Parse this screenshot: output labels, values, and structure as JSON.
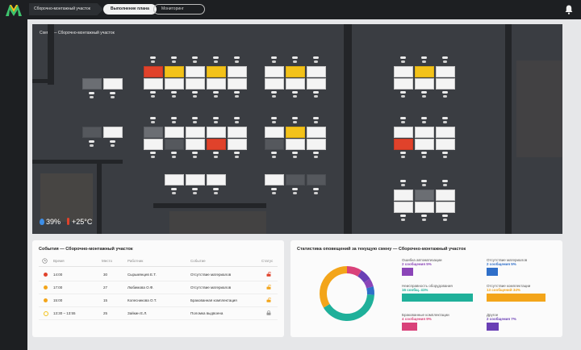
{
  "topbar": {
    "breadcrumb": "Сборочно-монтажный участок",
    "tab_active": "Выполнение плана",
    "tab_other": "Мониторинг"
  },
  "map": {
    "title": "Схема — Сборочно-монтажный участок",
    "humidity": "39%",
    "temperature": "+25°C"
  },
  "events": {
    "title": "События — Сборочно-монтажный участок",
    "columns": [
      "Время",
      "Место",
      "Работник",
      "Событие",
      "Статус"
    ],
    "rows": [
      {
        "time": "14:00",
        "place": "30",
        "worker": "Сырьмянцев Е.Т.",
        "event": "Отсутствие материалов",
        "level": "red"
      },
      {
        "time": "17:00",
        "place": "27",
        "worker": "Любимова О.Ф.",
        "event": "Отсутствие материалов",
        "level": "orange"
      },
      {
        "time": "15:00",
        "place": "15",
        "worker": "Колесникова О.Т.",
        "event": "Бракованная комплектация",
        "level": "orange"
      },
      {
        "time": "13:30 – 13:55",
        "place": "25",
        "worker": "Зайкин Е.Л.",
        "event": "Поломка выдвоена",
        "level": "open"
      }
    ],
    "colors": {
      "red": "#e0422b",
      "orange": "#f3a51a",
      "open": "#f3c21a"
    }
  },
  "stats": {
    "title": "Статистика оповещений за текущую смену — Сборочно-монтажный участок",
    "items": [
      {
        "label": "Ошибка автоматизации",
        "sub": "2 сообщения 5%",
        "value": 5,
        "color": "#8b45b8"
      },
      {
        "label": "Отсутствие материалов",
        "sub": "2 сообщения 5%",
        "value": 5,
        "color": "#2f6fc9"
      },
      {
        "label": "Неисправность оборудования",
        "sub": "16 сообщ. 41%",
        "value": 41,
        "color": "#1fb09a"
      },
      {
        "label": "Отсутствие комплектации",
        "sub": "13 сообщений 34%",
        "value": 34,
        "color": "#f3a51a"
      },
      {
        "label": "Бракованные комплектации",
        "sub": "4 сообщения 9%",
        "value": 9,
        "color": "#d9427a"
      },
      {
        "label": "Другое",
        "sub": "2 сообщения 7%",
        "value": 7,
        "color": "#6a3fb5"
      }
    ]
  }
}
